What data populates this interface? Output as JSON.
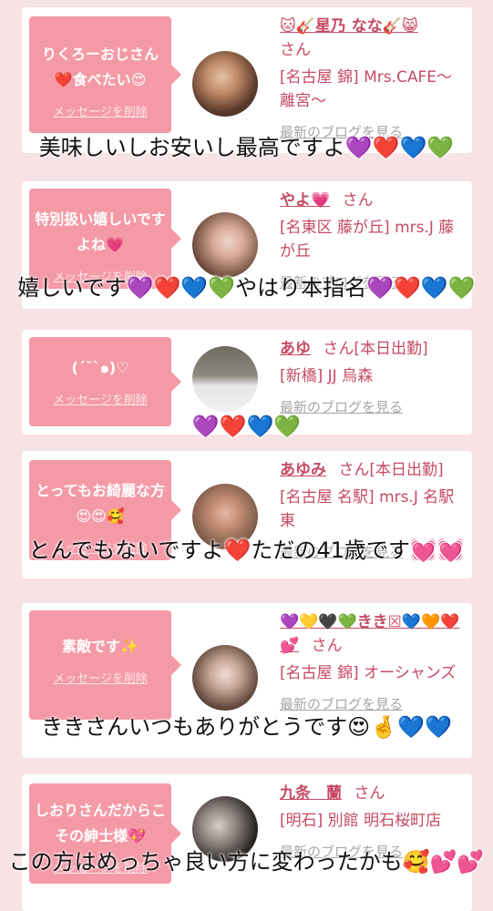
{
  "cards": [
    {
      "bubble": "りくろーおじさん❤️食べたい😍",
      "delete": "メッセージを削除",
      "name": "🐱🎸星乃 なな🎸😸",
      "san": "さん",
      "store": "[名古屋 錦] Mrs.CAFE～離宮～",
      "blog": "最新のブログを見る",
      "overlay": "美味しいしお安いし最高ですよ💜❤️💙💚"
    },
    {
      "bubble": "特別扱い嬉しいですよね💗",
      "delete": "メッセージを削除",
      "name": "やよ💗",
      "san": "さん",
      "store": "[名東区 藤が丘] mrs.J 藤が丘",
      "blog": "最新のブログを見る",
      "overlay": "嬉しいです💜❤️💙💚やはり本指名💜❤️💙💚"
    },
    {
      "bubble": "(´˘`๑)♡",
      "delete": "メッセージを削除",
      "name": "あゆ",
      "san": "さん[本日出勤]",
      "store": "[新橋] JJ 烏森",
      "blog": "最新のブログを見る",
      "overlay": "💜❤️💙💚"
    },
    {
      "bubble": "とってもお綺麗な方😍😍🥰",
      "delete": "メッセージを削除",
      "name": "あゆみ",
      "san": "さん[本日出勤]",
      "store": "[名古屋 名駅] mrs.J 名駅東",
      "blog": "最新のブログを見る",
      "overlay": "とんでもないですよ❤️ただの41歳です💓💓"
    },
    {
      "bubble": "素敵です✨",
      "delete": "メッセージを削除",
      "name": "💜💛🖤💚きき☒💙🧡❤️💕",
      "san": "さん",
      "store": "[名古屋 錦] オーシャンズ",
      "blog": "最新のブログを見る",
      "overlay": "ききさんいつもありがとうです😍🤞💙💙"
    },
    {
      "bubble": "しおりさんだからこその紳士様💖",
      "delete": "メッセージを削除",
      "name": "九条　蘭",
      "san": "さん",
      "store": "[明石] 別館 明石桜町店",
      "blog": "最新のブログを見る",
      "overlay": "この方はめっちゃ良い方に変わったかも🥰💕💕"
    }
  ],
  "colors": {
    "accent": "#c64a64",
    "bubble": "#f49aa7",
    "background": "#f7e3e6"
  },
  "icons": [
    "avatar-photo"
  ]
}
